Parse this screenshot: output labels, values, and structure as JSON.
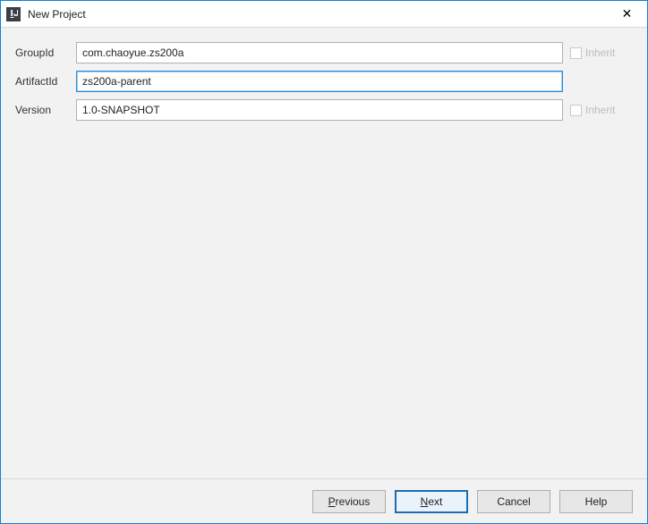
{
  "titlebar": {
    "title": "New Project"
  },
  "form": {
    "groupId": {
      "label": "GroupId",
      "value": "com.chaoyue.zs200a",
      "inheritLabel": "Inherit"
    },
    "artifactId": {
      "label": "ArtifactId",
      "value": "zs200a-parent"
    },
    "version": {
      "label": "Version",
      "value": "1.0-SNAPSHOT",
      "inheritLabel": "Inherit"
    }
  },
  "buttons": {
    "previous": {
      "mnemonic": "P",
      "rest": "revious"
    },
    "next": {
      "mnemonic": "N",
      "rest": "ext"
    },
    "cancel": "Cancel",
    "help": "Help"
  }
}
